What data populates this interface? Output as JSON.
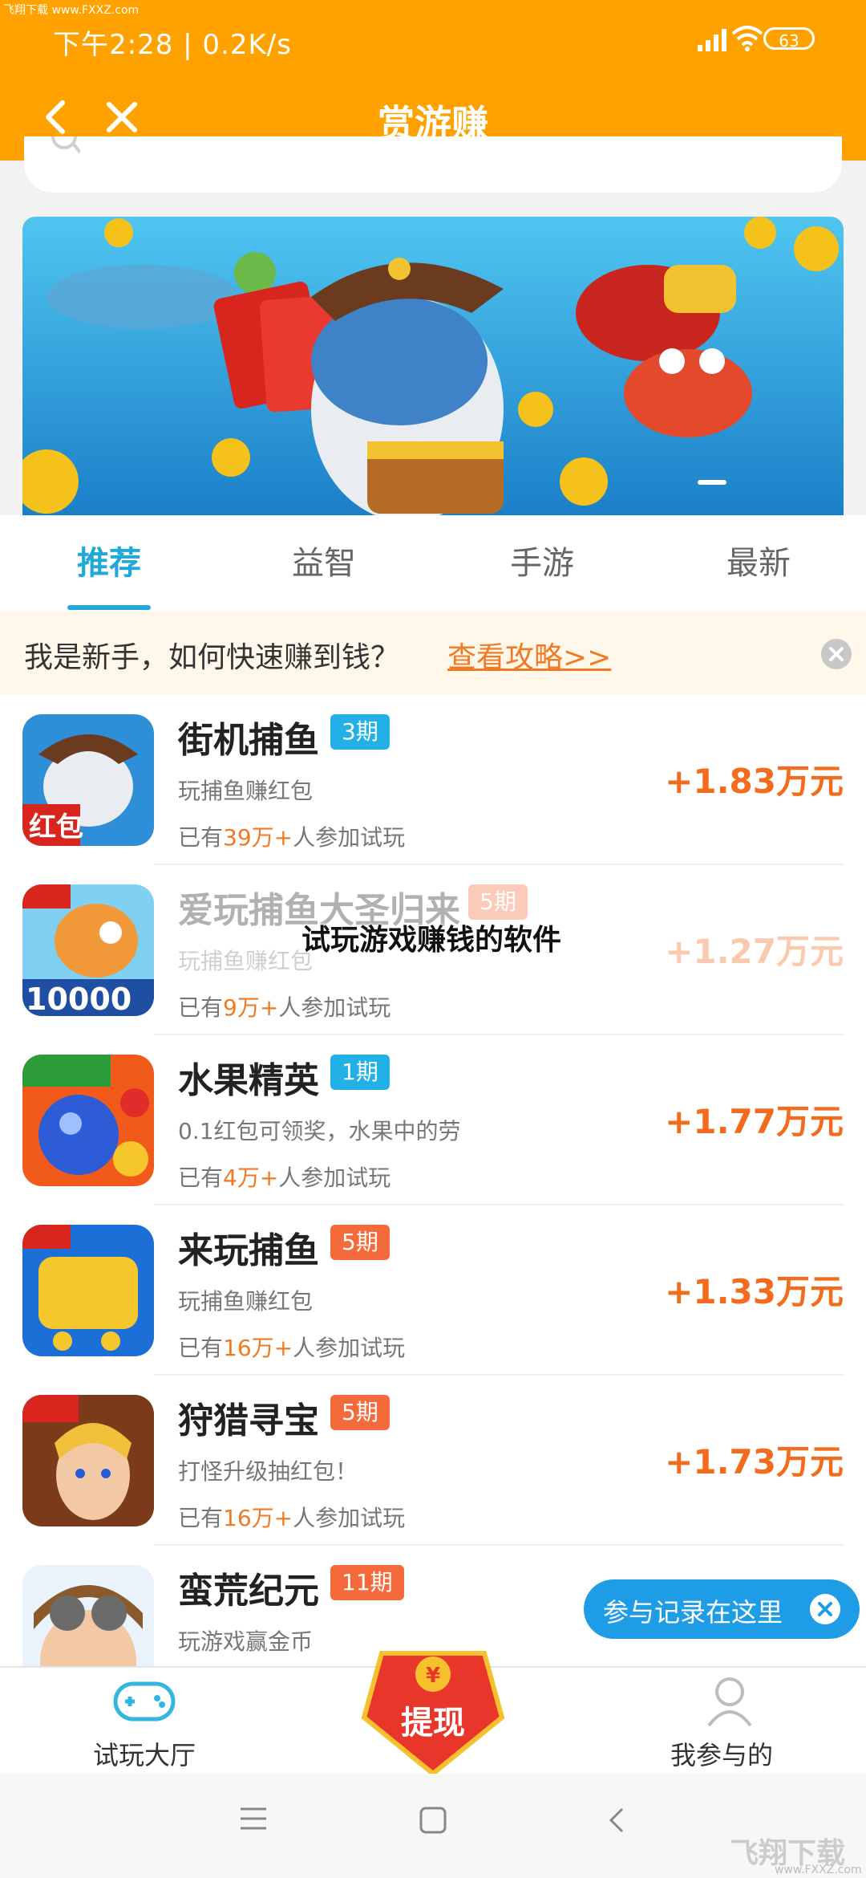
{
  "status": {
    "time": "下午2:28 | 0.2K/s",
    "battery": "63",
    "watermark": "飞翔下载 www.FXXZ.com"
  },
  "nav": {
    "title": "赏游赚"
  },
  "tabs": [
    {
      "label": "推荐",
      "active": true
    },
    {
      "label": "益智",
      "active": false
    },
    {
      "label": "手游",
      "active": false
    },
    {
      "label": "最新",
      "active": false
    }
  ],
  "guide": {
    "text": "我是新手，如何快速赚到钱？",
    "link": "查看攻略>>"
  },
  "games": [
    {
      "name": "街机捕鱼",
      "badge": "3期",
      "badge_color": "#22b1e6",
      "desc": "玩捕鱼赚红包",
      "count_prefix": "已有",
      "count": "39万+",
      "count_suffix": "人参加试玩",
      "reward": "+1.83万元"
    },
    {
      "name": "爱玩捕鱼大圣归来",
      "badge": "5期",
      "badge_color": "#f46a3a",
      "desc": "玩捕鱼赚红包",
      "count_prefix": "已有",
      "count": "9万+",
      "count_suffix": "人参加试玩",
      "reward": "+1.27万元"
    },
    {
      "name": "水果精英",
      "badge": "1期",
      "badge_color": "#22b1e6",
      "desc": "0.1红包可领奖，水果中的劳",
      "count_prefix": "已有",
      "count": "4万+",
      "count_suffix": "人参加试玩",
      "reward": "+1.77万元"
    },
    {
      "name": "来玩捕鱼",
      "badge": "5期",
      "badge_color": "#f46a3a",
      "desc": "玩捕鱼赚红包",
      "count_prefix": "已有",
      "count": "16万+",
      "count_suffix": "人参加试玩",
      "reward": "+1.33万元"
    },
    {
      "name": "狩猎寻宝",
      "badge": "5期",
      "badge_color": "#f46a3a",
      "desc": "打怪升级抽红包！",
      "count_prefix": "已有",
      "count": "16万+",
      "count_suffix": "人参加试玩",
      "reward": "+1.73万元"
    },
    {
      "name": "蛮荒纪元",
      "badge": "11期",
      "badge_color": "#f46a3a",
      "desc": "玩游戏赢金币",
      "count_prefix": "",
      "count": "",
      "count_suffix": "",
      "reward": ""
    }
  ],
  "overlay_caption": "试玩游戏赚钱的软件",
  "tip": {
    "text": "参与记录在这里"
  },
  "bottom": {
    "left_label": "试玩大厅",
    "center_label": "提现",
    "center_coin": "¥",
    "right_label": "我参与的"
  },
  "brand": {
    "name": "飞翔下载",
    "url": "www.FXXZ.com"
  },
  "colors": {
    "header": "#ffa200",
    "accent_blue": "#20a8d8",
    "reward_orange": "#f36b1c"
  }
}
